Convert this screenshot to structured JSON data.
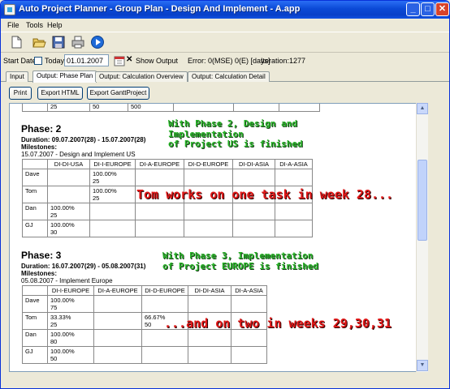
{
  "window": {
    "title": "Auto Project Planner - Group Plan - Design And Implement - A.app",
    "min_glyph": "_",
    "max_glyph": "□",
    "close_glyph": "✕"
  },
  "menu": [
    "File",
    "Tools",
    "Help"
  ],
  "toolbar": [
    "new-doc-icon",
    "open-folder-icon",
    "save-icon",
    "print-icon",
    "run-icon"
  ],
  "options": {
    "start_date_label": "Start Date",
    "today_label": "Today",
    "date_value": "01.01.2007",
    "show_output_label": "Show Output",
    "error_text": "Error: 0(MSE) 0(E) [days]",
    "iteration_text": "Iteration:1277"
  },
  "tabs": [
    "Input",
    "Output: Phase Plan",
    "Output: Calculation Overview",
    "Output: Calculation Detail"
  ],
  "buttons": {
    "print": "Print",
    "export_html": "Export HTML",
    "export_gantt": "Export GanttProject"
  },
  "top_row": [
    "25",
    "50",
    "500"
  ],
  "phase2": {
    "title": "Phase: 2",
    "duration": "Duration: 09.07.2007(28) - 15.07.2007(28)",
    "milestones_label": "Milestones:",
    "milestone": "15.07.2007 - Design and Implement US",
    "columns": [
      "",
      "DI-DI-USA",
      "DI-I-EUROPE",
      "DI-A-EUROPE",
      "DI-D-EUROPE",
      "DI-DI-ASIA",
      "DI-A-ASIA"
    ],
    "rows": [
      [
        "Dave",
        "",
        "100.00%\n25",
        "",
        "",
        "",
        ""
      ],
      [
        "Tom",
        "",
        "100.00%\n25",
        "",
        "",
        "",
        ""
      ],
      [
        "Dan",
        "100.00%\n25",
        "",
        "",
        "",
        "",
        ""
      ],
      [
        "GJ",
        "100.00%\n30",
        "",
        "",
        "",
        "",
        ""
      ]
    ]
  },
  "phase3": {
    "title": "Phase: 3",
    "duration": "Duration: 16.07.2007(29) - 05.08.2007(31)",
    "milestones_label": "Milestones:",
    "milestone": "05.08.2007 - Implement Europe",
    "columns": [
      "",
      "DI-I-EUROPE",
      "DI-A-EUROPE",
      "DI-D-EUROPE",
      "DI-DI-ASIA",
      "DI-A-ASIA"
    ],
    "rows": [
      [
        "Dave",
        "100.00%\n75",
        "",
        "",
        "",
        ""
      ],
      [
        "Tom",
        "33.33%\n25",
        "",
        "66.67%\n50",
        "",
        ""
      ],
      [
        "Dan",
        "100.00%\n80",
        "",
        "",
        "",
        ""
      ],
      [
        "GJ",
        "100.00%\n50",
        "",
        "",
        "",
        ""
      ]
    ]
  },
  "annotations": {
    "green1": "With Phase 2, Design and\nImplementation\nof Project US is finished",
    "red1": "Tom works on one task in week 28...",
    "green2": "With Phase 3, Implementation\nof Project EUROPE is finished",
    "red2": "...and on two in weeks 29,30,31"
  }
}
